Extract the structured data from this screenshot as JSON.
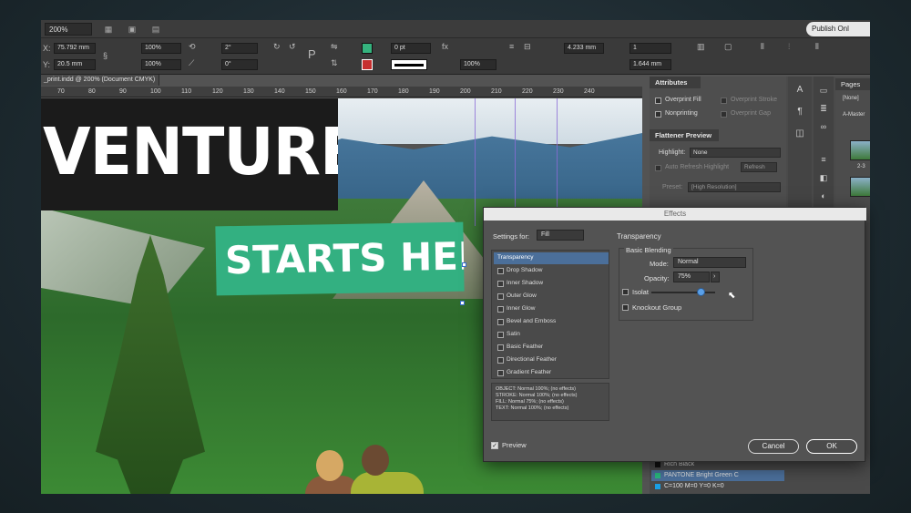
{
  "topbar": {
    "zoom": "200%",
    "publish_label": "Publish Onl"
  },
  "control": {
    "x": "75.792 mm",
    "y": "20.5 mm",
    "scale_x": "100%",
    "scale_y": "100%",
    "rotate": "2°",
    "shear": "0°",
    "stroke_weight": "0 pt",
    "opacity": "100%",
    "width_pt": "4.233 mm",
    "cols": "1",
    "gutter": "1.644 mm"
  },
  "doc_tab": "_print.indd @ 200% (Document CMYK)",
  "ruler_ticks": [
    "70",
    "80",
    "90",
    "100",
    "110",
    "120",
    "130",
    "140",
    "150",
    "160",
    "170",
    "180",
    "190",
    "200",
    "210",
    "220",
    "230",
    "240"
  ],
  "canvas": {
    "headline": "VENTURE",
    "subhead": "STARTS HERE"
  },
  "attributes_panel": {
    "tab": "Attributes",
    "overprint_fill": "Overprint Fill",
    "overprint_stroke": "Overprint Stroke",
    "nonprinting": "Nonprinting",
    "overprint_gap": "Overprint Gap",
    "flattener_tab": "Flattener Preview",
    "highlight_label": "Highlight:",
    "highlight_value": "None",
    "auto_refresh": "Auto Refresh Highlight",
    "refresh_btn": "Refresh",
    "preset_label": "Preset:",
    "preset_value": "[High Resolution]"
  },
  "pages_panel": {
    "tab": "Pages",
    "none": "[None]",
    "master": "A-Master",
    "spread_label": "2-3"
  },
  "swatches": [
    {
      "name": "Rich Black",
      "color": "#111111"
    },
    {
      "name": "PANTONE Bright Green C",
      "color": "#29b77c"
    },
    {
      "name": "C=100 M=0 Y=0 K=0",
      "color": "#1aa0e6"
    }
  ],
  "effects_dialog": {
    "title": "Effects",
    "settings_for_label": "Settings for:",
    "settings_for_value": "Fill",
    "section_title": "Transparency",
    "basic_blending": "Basic Blending",
    "mode_label": "Mode:",
    "mode_value": "Normal",
    "opacity_label": "Opacity:",
    "opacity_value": "75%",
    "opacity_fraction": 0.75,
    "isolate_label": "Isolat",
    "knockout_label": "Knockout Group",
    "effects": [
      "Transparency",
      "Drop Shadow",
      "Inner Shadow",
      "Outer Glow",
      "Inner Glow",
      "Bevel and Emboss",
      "Satin",
      "Basic Feather",
      "Directional Feather",
      "Gradient Feather"
    ],
    "summary": [
      "OBJECT: Normal 100%; (no effects)",
      "STROKE: Normal 100%; (no effects)",
      "FILL: Normal 75%; (no effects)",
      "TEXT: Normal 100%; (no effects)"
    ],
    "preview_label": "Preview",
    "cancel_label": "Cancel",
    "ok_label": "OK"
  },
  "colors": {
    "accent_green": "#33b081",
    "selection_blue": "#4b6f9a"
  }
}
